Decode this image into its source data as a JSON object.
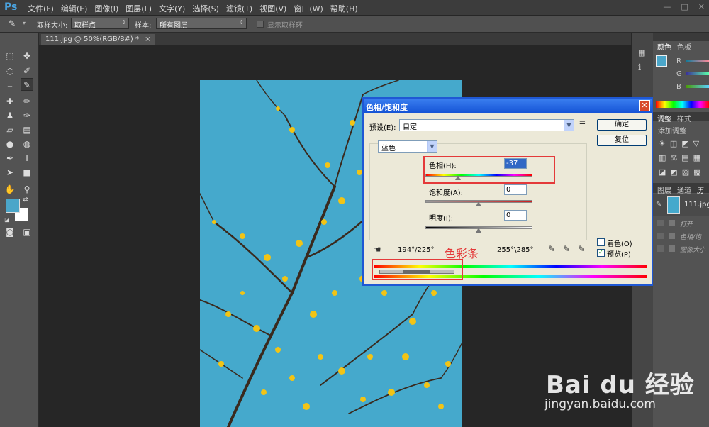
{
  "app": {
    "logo": "Ps"
  },
  "menubar": {
    "items": [
      "文件(F)",
      "编辑(E)",
      "图像(I)",
      "图层(L)",
      "文字(Y)",
      "选择(S)",
      "滤镜(T)",
      "视图(V)",
      "窗口(W)",
      "帮助(H)"
    ],
    "window_controls": [
      "—",
      "□",
      "✕"
    ]
  },
  "options_bar": {
    "sample_size_label": "取样大小:",
    "sample_size_value": "取样点",
    "sample_label": "样本:",
    "sample_value": "所有图层",
    "show_ring_label": "显示取样环"
  },
  "document_tab": {
    "title": "111.jpg @ 50%(RGB/8#) *",
    "close": "×"
  },
  "panels": {
    "color_tab": "颜色",
    "swatches_tab": "色板",
    "channels": [
      "R",
      "G",
      "B"
    ],
    "adjust_tab": "调整",
    "styles_tab": "样式",
    "add_adjust_label": "添加调整",
    "layers_tab": "图层",
    "paths_tab": "通道",
    "history_tab": "历史",
    "history_items": [
      {
        "label": "111.jpg"
      },
      {
        "label": "打开"
      },
      {
        "label": "色相/饱"
      },
      {
        "label": "图像大小"
      }
    ]
  },
  "dialog": {
    "title": "色相/饱和度",
    "close": "✕",
    "preset_label": "预设(E):",
    "preset_value": "自定",
    "ok_button": "确定",
    "reset_button": "复位",
    "channel_value": "蓝色",
    "hue_label": "色相(H):",
    "hue_value": "-37",
    "saturation_label": "饱和度(A):",
    "saturation_value": "0",
    "lightness_label": "明度(I):",
    "lightness_value": "0",
    "range_left": "194°/225°",
    "range_right": "255°\\285°",
    "colorize_label": "着色(O)",
    "preview_label": "预览(P)",
    "preview_checked": "✓"
  },
  "annotation": {
    "text": "色彩条",
    "color": "#e43a3a"
  },
  "watermark": {
    "logo": "Bai du 经验",
    "url": "jingyan.baidu.com"
  },
  "colors": {
    "foreground": "#4ba6c9",
    "background": "#ffffff",
    "sky": "#45a9cc",
    "accent": "#1f58d4"
  }
}
